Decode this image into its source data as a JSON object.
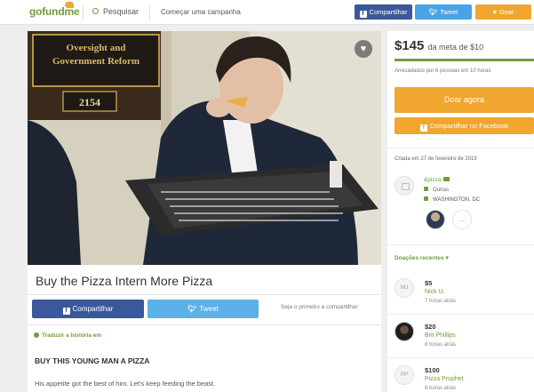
{
  "header": {
    "logo": "gofundme",
    "search_label": "Pesquisar",
    "start_campaign_label": "Começar uma campanha",
    "share_facebook_label": "Compartilhar",
    "tweet_label": "Tweet",
    "donate_label": "Doar"
  },
  "campaign": {
    "title": "Buy the Pizza Intern More Pizza",
    "share_facebook_label": "Compartilhar",
    "tweet_label": "Tweet",
    "be_first_label": "Seja o primeiro a compartilhar",
    "translate_label": "Traduzir a história em",
    "story_heading": "BUY THIS YOUNG MAN A PIZZA",
    "story_body": "His appetite got the best of him. Let's keep feeding the beast.",
    "photo": {
      "sign_line1": "Oversight and",
      "sign_line2": "Government Reform",
      "room_number": "2154"
    }
  },
  "sidebar": {
    "raised": "$145",
    "goal": "da meta de $10",
    "progress_fraction": 1.0,
    "raised_summary": "Arrecadados por 6 pessoas em 10 horas",
    "donate_now_label": "Doar agora",
    "share_facebook_label": "Compartilhar no Facebook",
    "created": "Criada em 27 de fevereiro de 2019",
    "organizer": {
      "name": "&pizza",
      "category": "Outras",
      "location": "WASHINGTON, DC"
    },
    "team_more": "...",
    "recent_donations_title": "Doações recentes",
    "donations": [
      {
        "initials": "NU",
        "amount": "$5",
        "name": "Nick U.",
        "time": "7 horas atrás"
      },
      {
        "initials": "",
        "amount": "$20",
        "name": "Brit Phillips",
        "time": "8 horas atrás"
      },
      {
        "initials": "PP",
        "amount": "$100",
        "name": "Pizza Prophet",
        "time": "8 horas atrás"
      }
    ]
  },
  "colors": {
    "brand_green": "#6e9e3a",
    "facebook_blue": "#3b5898",
    "twitter_blue": "#4aa3e4",
    "donate_orange": "#f1a630"
  }
}
